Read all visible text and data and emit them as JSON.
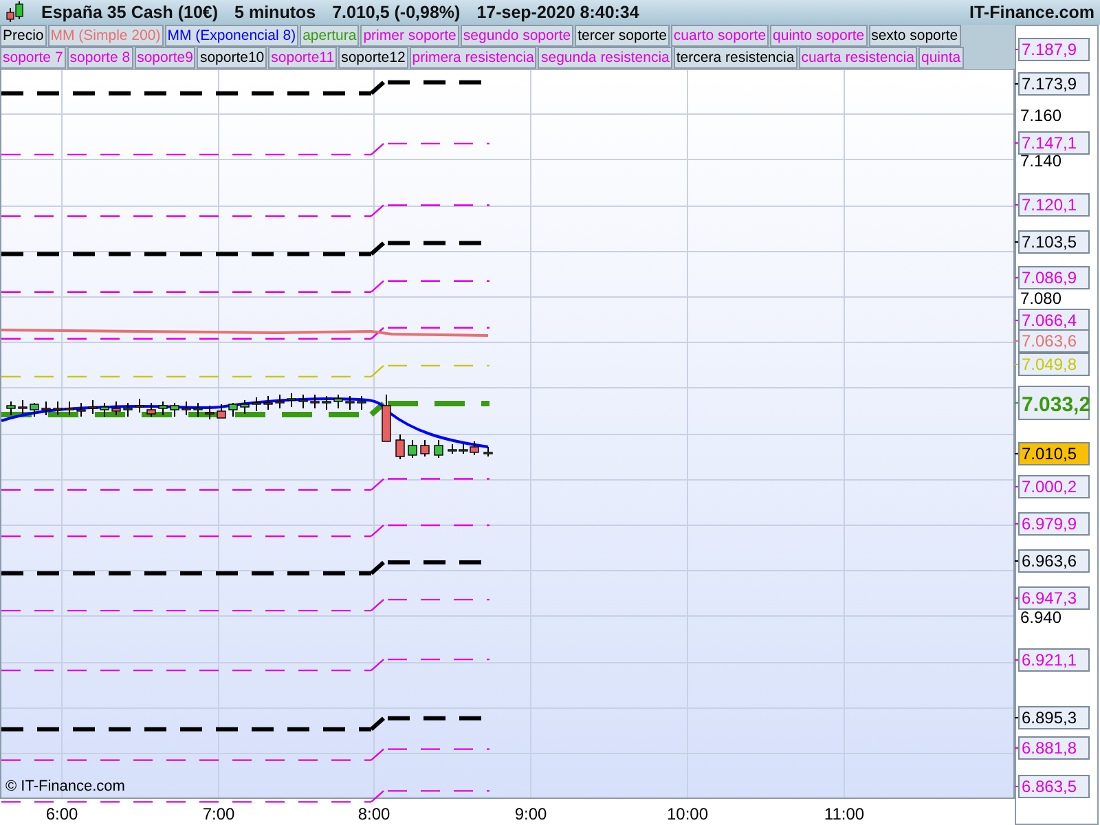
{
  "header": {
    "title": "España 35 Cash (10€)",
    "interval": "5 minutos",
    "price": "7.010,5 (-0,98%)",
    "datetime": "17-sep-2020 8:40:34",
    "brand": "IT-Finance.com"
  },
  "legend": [
    [
      {
        "label": "Precio",
        "color": "#000000"
      },
      {
        "label": "MM (Simple 200)",
        "color": "#e87070"
      },
      {
        "label": "MM (Exponencial 8)",
        "color": "#0000ff"
      },
      {
        "label": "apertura",
        "color": "#3a9a10"
      },
      {
        "label": "primer soporte",
        "color": "#e000e0"
      },
      {
        "label": "segundo soporte",
        "color": "#e000e0"
      },
      {
        "label": "tercer soporte",
        "color": "#000000"
      },
      {
        "label": "cuarto soporte",
        "color": "#e000e0"
      },
      {
        "label": "quinto soporte",
        "color": "#e000e0"
      },
      {
        "label": "sexto soporte",
        "color": "#000000"
      }
    ],
    [
      {
        "label": "soporte 7",
        "color": "#e000e0"
      },
      {
        "label": "soporte 8",
        "color": "#e000e0"
      },
      {
        "label": "soporte9",
        "color": "#e000e0"
      },
      {
        "label": "soporte10",
        "color": "#000000"
      },
      {
        "label": "soporte11",
        "color": "#e000e0"
      },
      {
        "label": "soporte12",
        "color": "#000000"
      },
      {
        "label": "primera resistencia",
        "color": "#e000e0"
      },
      {
        "label": "segunda resistencia",
        "color": "#e000e0"
      },
      {
        "label": "tercera resistencia",
        "color": "#000000"
      },
      {
        "label": "cuarta resistencia",
        "color": "#e000e0"
      },
      {
        "label": "quinta",
        "color": "#e000e0"
      }
    ]
  ],
  "chart": {
    "price_labels": [
      {
        "label": "7.187,9",
        "color": "#e000e0",
        "kind": "mark"
      },
      {
        "label": "7.173,9",
        "color": "#000000",
        "kind": "thick"
      },
      {
        "label": "7.147,1",
        "color": "#e000e0",
        "kind": "thin"
      },
      {
        "label": "7.120,1",
        "color": "#e000e0",
        "kind": "thin"
      },
      {
        "label": "7.103,5",
        "color": "#000000",
        "kind": "thick"
      },
      {
        "label": "7.086,9",
        "color": "#e000e0",
        "kind": "thin"
      },
      {
        "label": "7.066,4",
        "color": "#e000e0",
        "kind": "thin"
      },
      {
        "label": "7.063,6",
        "color": "#e87070",
        "kind": "ma"
      },
      {
        "label": "7.049,8",
        "color": "#c8c800",
        "kind": "thin"
      },
      {
        "label": "7.033,2",
        "color": "#3a9a10",
        "kind": "open"
      },
      {
        "label": "7.010,5",
        "kind": "current"
      },
      {
        "label": "7.000,2",
        "color": "#e000e0",
        "kind": "thin"
      },
      {
        "label": "6.979,9",
        "color": "#e000e0",
        "kind": "thin"
      },
      {
        "label": "6.963,6",
        "color": "#000000",
        "kind": "thick"
      },
      {
        "label": "6.947,3",
        "color": "#e000e0",
        "kind": "thin"
      },
      {
        "label": "6.921,1",
        "color": "#e000e0",
        "kind": "thin"
      },
      {
        "label": "6.895,3",
        "color": "#000000",
        "kind": "thick"
      },
      {
        "label": "6.881,8",
        "color": "#e000e0",
        "kind": "thin"
      },
      {
        "label": "6.863,5",
        "color": "#e000e0",
        "kind": "thin"
      }
    ],
    "y_ticks": [
      "7.160",
      "7.140",
      "7.080",
      "6.940"
    ],
    "x_ticks": [
      "6:00",
      "7:00",
      "8:00",
      "9:00",
      "10:00",
      "11:00"
    ],
    "credit": "© IT-Finance.com"
  }
}
